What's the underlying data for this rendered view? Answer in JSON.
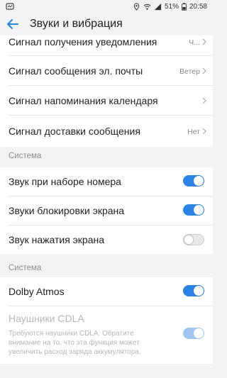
{
  "status_bar": {
    "battery_percent": "51%",
    "time": "20:58",
    "icons": [
      "location-icon",
      "wifi-icon",
      "signal-icon",
      "battery-icon"
    ]
  },
  "app_bar": {
    "title": "Звуки и вибрация"
  },
  "rows_top": [
    {
      "label": "Сигнал получения уведомления",
      "value": "Ч..."
    },
    {
      "label": "Сигнал сообщения эл. почты",
      "value": "Ветер"
    },
    {
      "label": "Сигнал напоминания календаря",
      "value": ""
    },
    {
      "label": "Сигнал доставки сообщения",
      "value": "Нет"
    }
  ],
  "section1": {
    "title": "Система",
    "items": [
      {
        "label": "Звук при наборе номера",
        "checked": true
      },
      {
        "label": "Звуки блокировки экрана",
        "checked": true
      },
      {
        "label": "Звук нажатия экрана",
        "checked": false
      }
    ]
  },
  "section2": {
    "title": "Система",
    "dolby": {
      "label": "Dolby Atmos",
      "checked": true
    },
    "cdla": {
      "label": "Наушники CDLA",
      "description": "Требуются наушники CDLA. Обратите внимание на то, что эта функция может увеличить расход заряда аккумулятора.",
      "checked": true,
      "enabled": false
    }
  },
  "colors": {
    "accent": "#2c83e6",
    "background": "#f3f3f5",
    "card": "#ffffff"
  }
}
